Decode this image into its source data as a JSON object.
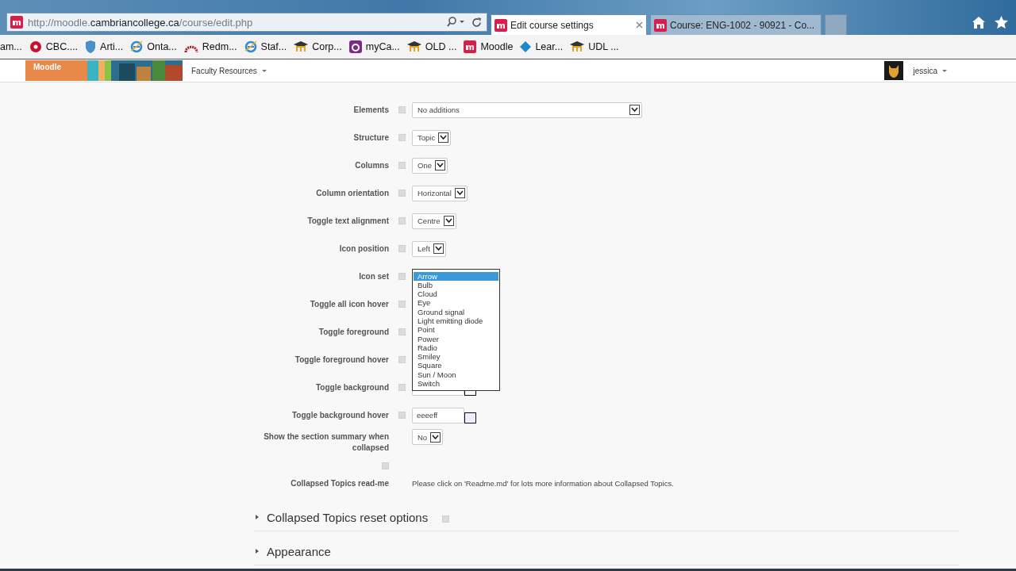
{
  "browser": {
    "address": "http://moodle.**cambriancollege.ca**/course/edit.php",
    "tabs": [
      {
        "title": "Edit course settings",
        "selected": true
      },
      {
        "title": "Course: ENG-1002 - 90921 - Co...",
        "selected": false
      }
    ],
    "bookmarks": [
      "am...",
      "CBC....",
      "Arti...",
      "Onta...",
      "Redm...",
      "Staf...",
      "Corp...",
      "myCa...",
      "OLD ...",
      "Moodle",
      "Lear...",
      "UDL ..."
    ]
  },
  "navbar": {
    "logo": "Moodle",
    "menu": "Faculty Resources",
    "user": "jessica"
  },
  "form": {
    "rows": [
      {
        "label": "Elements",
        "kind": "select",
        "value": "No additions",
        "wide": true
      },
      {
        "label": "Structure",
        "kind": "select",
        "value": "Topic"
      },
      {
        "label": "Columns",
        "kind": "select",
        "value": "One"
      },
      {
        "label": "Column orientation",
        "kind": "select",
        "value": "Horizontal"
      },
      {
        "label": "Toggle text alignment",
        "kind": "select",
        "value": "Centre"
      },
      {
        "label": "Icon position",
        "kind": "select",
        "value": "Left"
      },
      {
        "label": "Icon set",
        "kind": "list",
        "options": [
          {
            "label": "Arrow",
            "selected": true
          },
          {
            "label": "Bulb",
            "selected": false
          },
          {
            "label": "Cloud",
            "selected": false
          },
          {
            "label": "Eye",
            "selected": false
          },
          {
            "label": "Ground signal",
            "selected": false
          },
          {
            "label": "Light emitting diode",
            "selected": false
          },
          {
            "label": "Point",
            "selected": false
          },
          {
            "label": "Power",
            "selected": false
          },
          {
            "label": "Radio",
            "selected": false
          },
          {
            "label": "Smiley",
            "selected": false
          },
          {
            "label": "Square",
            "selected": false
          },
          {
            "label": "Sun / Moon",
            "selected": false
          },
          {
            "label": "Switch",
            "selected": false
          }
        ]
      },
      {
        "label": "Toggle all icon hover",
        "kind": "covered"
      },
      {
        "label": "Toggle foreground",
        "kind": "covered"
      },
      {
        "label": "Toggle foreground hover",
        "kind": "covered"
      },
      {
        "label": "Toggle background",
        "kind": "color"
      },
      {
        "label": "Toggle background hover",
        "kind": "color",
        "value": "eeeeff",
        "color": "#eeeeff"
      },
      {
        "label": "Show the section summary when collapsed",
        "kind": "select",
        "value": "No",
        "help_below": true
      },
      {
        "label": "Collapsed Topics read-me",
        "kind": "text",
        "value": "Please click on 'Readme.md' for lots more information about Collapsed Topics."
      }
    ]
  },
  "sections": [
    {
      "title": "Collapsed Topics reset options",
      "expanded": false,
      "help": true
    },
    {
      "title": "Appearance",
      "expanded": false,
      "help": false
    }
  ]
}
